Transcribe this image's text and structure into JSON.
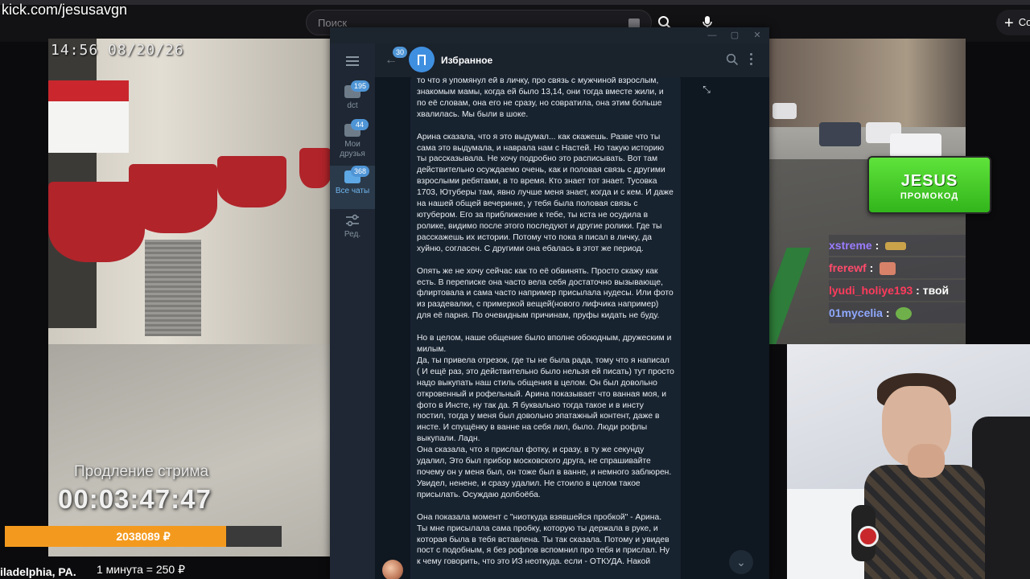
{
  "stream": {
    "url": "kick.com/jesusavgn",
    "timestamp": "14:56 08/20/26",
    "extension_title": "Продление стрима",
    "extension_timer": "00:03:47:47",
    "goal_amount": "2038089 ₽",
    "goal_fill_fraction": 0.8,
    "city": "iladelphia, PA.",
    "rate": "1 минута = 250 ₽",
    "promo_top": "JESUS",
    "promo_bottom": "ПРОМОКОД",
    "brand_color": "#53d63a"
  },
  "browser": {
    "search_placeholder": "Поиск",
    "create_label": "Co",
    "icons": [
      "search-icon",
      "mic-icon",
      "plus-icon"
    ]
  },
  "chat_overlay": [
    {
      "user": "xstreme",
      "text": ":",
      "color": "#9a7cff"
    },
    {
      "user": "frerewf",
      "text": ":",
      "color": "#ff4b6b"
    },
    {
      "user": "lyudi_holiye193",
      "text": ": твой",
      "color": "#ff3b5c"
    },
    {
      "user": "01mycelia",
      "text": ":",
      "color": "#8fa8ff"
    }
  ],
  "telegram": {
    "back_badge": "30",
    "chat_title": "Избранное",
    "folders": [
      {
        "label": "dct",
        "badge": "195",
        "active": false
      },
      {
        "label": "Мои друзья",
        "badge": "44",
        "active": false
      },
      {
        "label": "Все чаты",
        "badge": "368",
        "active": true
      },
      {
        "label": "Ред.",
        "badge": "",
        "active": false
      }
    ],
    "accent": "#4f95d6",
    "message": [
      "то что я упомянул ей в личку, про связь с мужчиной взрослым, знакомым мамы, когда ей было 13,14, они тогда вместе жили, и по её словам, она его не сразу, но совратила, она этим больше хвалилась. Мы были в шоке.",
      "Арина сказала, что я это выдумал... как скажешь. Разве что ты сама это выдумала, и наврала нам с Настей. Но такую историю ты рассказывала. Не хочу подробно это расписывать. Вот там действительно осуждаемо очень, как и половая связь с другими взрослыми ребятами, в то время. Кто знает тот знает. Тусовка 1703, Ютуберы там, явно лучше меня знает, когда и с кем. И даже на нашей общей вечеринке, у тебя была половая связь с ютубером. Его за приближение к тебе, ты кста не осудила в ролике, видимо после этого последуют и другие ролики. Где ты расскажешь их истории. Потому что пока я писал в личку, да хуйню, согласен. С другими она ебалась в этот же период.",
      "Опять же не хочу сейчас как то её обвинять. Просто скажу как есть. В переписке она часто вела себя достаточно вызывающе, флиртовала и сама часто например присылала нудесы. Или фото из раздевалки, с примеркой вещей(нового лифчика например) для её парня. По очевидным причинам, пруфы кидать не буду.",
      "Но в целом, наше общение было вполне обоюдным, дружеским и милым.\nДа, ты привела отрезок, где ты не была рада, тому что я написал ( И ещё раз, это действительно было нельзя ей писать) тут просто надо выкупать наш стиль общения в целом. Он был довольно откровенный и рофельный. Арина показывает что ванная моя, и фото в Инсте, ну так да. Я буквально тогда такое и в инсту постил, тогда у меня был довольно эпатажный контент, даже в инсте. И спущёнку в ванне на себя лил, было. Люди рофлы выкупали. Ладн.\nОна сказала, что я прислал фотку, и сразу, в ту же секунду удалил, Это был прибор московского друга, не спрашивайте почему он у меня был, он тоже был в ванне, и немного заблюрен. Увидел, ненене, и сразу удалил. Не стоило в целом такое присылать. Осуждаю долбоёба.",
      "Она показала момент с \"ниоткуда взявшейся пробкой\" - Арина. Ты мне присылала сама пробку, которую ты держала в руке, и которая была в тебя вставлена. Ты так сказала. Потому и увидев пост с подобным, я без рофлов вспомнил про тебя и прислал. Ну к чему говорить, что это ИЗ неоткуда. если - ОТКУДА. Накой"
    ]
  }
}
